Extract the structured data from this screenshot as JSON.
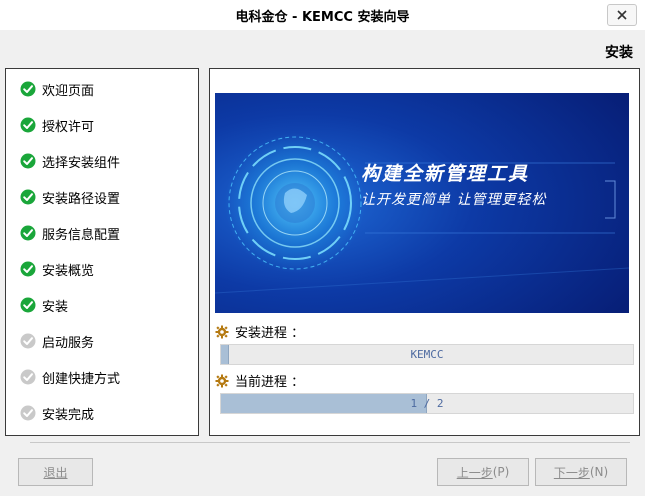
{
  "window": {
    "title": "电科金仓 - KEMCC 安装向导"
  },
  "page": {
    "heading": "安装"
  },
  "steps": [
    {
      "label": "欢迎页面",
      "done": true
    },
    {
      "label": "授权许可",
      "done": true
    },
    {
      "label": "选择安装组件",
      "done": true
    },
    {
      "label": "安装路径设置",
      "done": true
    },
    {
      "label": "服务信息配置",
      "done": true
    },
    {
      "label": "安装概览",
      "done": true
    },
    {
      "label": "安装",
      "done": true
    },
    {
      "label": "启动服务",
      "done": false
    },
    {
      "label": "创建快捷方式",
      "done": false
    },
    {
      "label": "安装完成",
      "done": false
    }
  ],
  "banner": {
    "title": "构建全新管理工具",
    "subtitle": "让开发更简单 让管理更轻松"
  },
  "progress": {
    "install_label": "安装进程 ：",
    "install_text": "KEMCC",
    "install_fraction": 0.02,
    "current_label": "当前进程 ：",
    "current_text": "1 / 2",
    "current_fraction": 0.5
  },
  "buttons": {
    "exit": "退出",
    "prev_main": "上一步",
    "prev_key": "(P)",
    "next_main": "下一步",
    "next_key": "(N)"
  },
  "colors": {
    "check_done": "#1aa63a",
    "check_pending": "#c9c9c9",
    "banner_bg": "#0a2a8c",
    "progress_fill": "#a9bfd6"
  }
}
